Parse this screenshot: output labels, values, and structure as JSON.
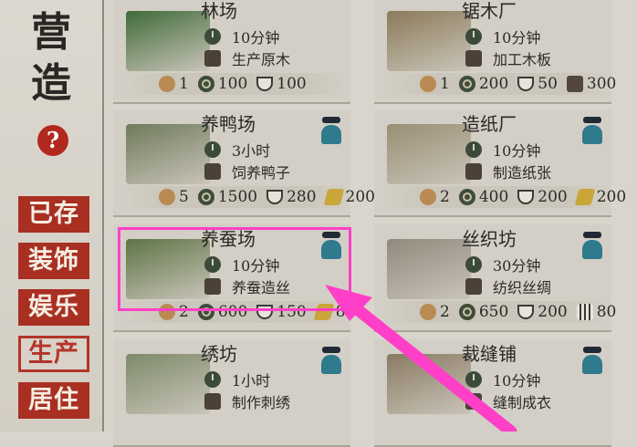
{
  "sidebar": {
    "title": "营造",
    "help": "?",
    "nav": [
      {
        "label": "已存",
        "active": false
      },
      {
        "label": "装饰",
        "active": false
      },
      {
        "label": "娱乐",
        "active": false
      },
      {
        "label": "生产",
        "active": true
      },
      {
        "label": "居住",
        "active": false
      }
    ]
  },
  "buildings": [
    {
      "name": "林场",
      "time": "10分钟",
      "output": "生产原木",
      "has_worker": false,
      "costs": [
        {
          "icon": "person-icon",
          "value": "1"
        },
        {
          "icon": "coin-icon",
          "value": "100"
        },
        {
          "icon": "food-icon",
          "value": "100"
        }
      ]
    },
    {
      "name": "锯木厂",
      "time": "10分钟",
      "output": "加工木板",
      "has_worker": false,
      "costs": [
        {
          "icon": "person-icon",
          "value": "1"
        },
        {
          "icon": "coin-icon",
          "value": "200"
        },
        {
          "icon": "food-icon",
          "value": "50"
        },
        {
          "icon": "wood-icon",
          "value": "300"
        }
      ]
    },
    {
      "name": "养鸭场",
      "time": "3小时",
      "output": "饲养鸭子",
      "has_worker": true,
      "costs": [
        {
          "icon": "person-icon",
          "value": "5"
        },
        {
          "icon": "coin-icon",
          "value": "1500"
        },
        {
          "icon": "food-icon",
          "value": "280"
        },
        {
          "icon": "board-icon",
          "value": "200"
        }
      ]
    },
    {
      "name": "造纸厂",
      "time": "10分钟",
      "output": "制造纸张",
      "has_worker": true,
      "costs": [
        {
          "icon": "person-icon",
          "value": "2"
        },
        {
          "icon": "coin-icon",
          "value": "400"
        },
        {
          "icon": "food-icon",
          "value": "200"
        },
        {
          "icon": "board-icon",
          "value": "200"
        }
      ]
    },
    {
      "name": "养蚕场",
      "time": "10分钟",
      "output": "养蚕造丝",
      "has_worker": true,
      "costs": [
        {
          "icon": "person-icon",
          "value": "2"
        },
        {
          "icon": "coin-icon",
          "value": "600"
        },
        {
          "icon": "food-icon",
          "value": "150"
        },
        {
          "icon": "board-icon",
          "value": "80"
        }
      ]
    },
    {
      "name": "丝织坊",
      "time": "30分钟",
      "output": "纺织丝绸",
      "has_worker": true,
      "costs": [
        {
          "icon": "person-icon",
          "value": "2"
        },
        {
          "icon": "coin-icon",
          "value": "650"
        },
        {
          "icon": "food-icon",
          "value": "200"
        },
        {
          "icon": "silk-icon",
          "value": "80"
        }
      ]
    },
    {
      "name": "绣坊",
      "time": "1小时",
      "output": "制作刺绣",
      "has_worker": true,
      "costs": []
    },
    {
      "name": "裁缝铺",
      "time": "10分钟",
      "output": "缝制成衣",
      "has_worker": true,
      "costs": []
    }
  ],
  "colors": {
    "highlight": "#ff3fc8",
    "nav_red": "#a92f23",
    "worker": "#2f7a8c"
  }
}
